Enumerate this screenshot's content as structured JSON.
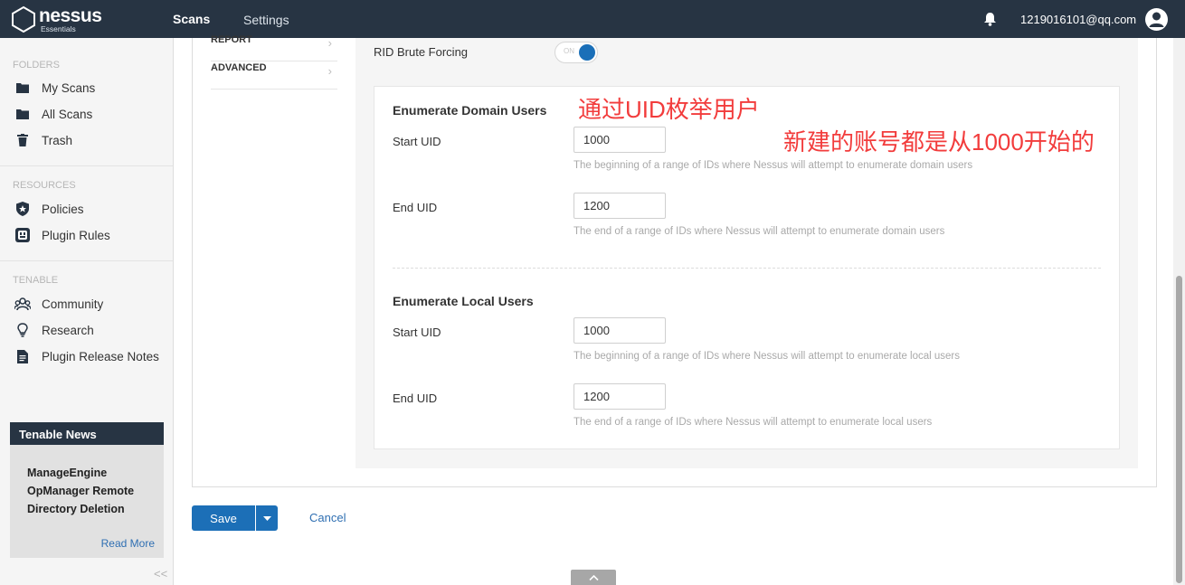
{
  "header": {
    "logo_name": "nessus",
    "logo_sub": "Essentials",
    "nav": {
      "scans": "Scans",
      "settings": "Settings"
    },
    "user_email": "1219016101@qq.com",
    "icons": [
      "bell-icon",
      "user-icon"
    ]
  },
  "sidebar": {
    "folders_heading": "FOLDERS",
    "folders": [
      {
        "label": "My Scans",
        "icon": "folder-icon"
      },
      {
        "label": "All Scans",
        "icon": "folder-icon"
      },
      {
        "label": "Trash",
        "icon": "trash-icon"
      }
    ],
    "resources_heading": "RESOURCES",
    "resources": [
      {
        "label": "Policies",
        "icon": "shield-star-icon"
      },
      {
        "label": "Plugin Rules",
        "icon": "plug-icon"
      }
    ],
    "tenable_heading": "TENABLE",
    "tenable": [
      {
        "label": "Community",
        "icon": "people-icon"
      },
      {
        "label": "Research",
        "icon": "lightbulb-icon"
      },
      {
        "label": "Plugin Release Notes",
        "icon": "document-icon"
      }
    ],
    "news": {
      "title": "Tenable News",
      "headline_1": "ManageEngine",
      "headline_2": "OpManager Remote",
      "headline_3": "Directory Deletion",
      "read_more": "Read More"
    },
    "collapse": "<<"
  },
  "subnav": {
    "report": "REPORT",
    "advanced": "ADVANCED"
  },
  "settings": {
    "rid_label": "RID Brute Forcing",
    "rid_toggle_text": "ON",
    "rid_enabled": true,
    "domain": {
      "title": "Enumerate Domain Users",
      "start_label": "Start UID",
      "start_value": "1000",
      "start_help": "The beginning of a range of IDs where Nessus will attempt to enumerate domain users",
      "end_label": "End UID",
      "end_value": "1200",
      "end_help": "The end of a range of IDs where Nessus will attempt to enumerate domain users"
    },
    "local": {
      "title": "Enumerate Local Users",
      "start_label": "Start UID",
      "start_value": "1000",
      "start_help": "The beginning of a range of IDs where Nessus will attempt to enumerate local users",
      "end_label": "End UID",
      "end_value": "1200",
      "end_help": "The end of a range of IDs where Nessus will attempt to enumerate local users"
    }
  },
  "annotations": {
    "line_1": "通过UID枚举用户",
    "line_2": "新建的账号都是从1000开始的"
  },
  "actions": {
    "save": "Save",
    "cancel": "Cancel"
  },
  "colors": {
    "header_bg": "#273443",
    "accent": "#1c6fb7",
    "annotation": "#f23c3c"
  }
}
